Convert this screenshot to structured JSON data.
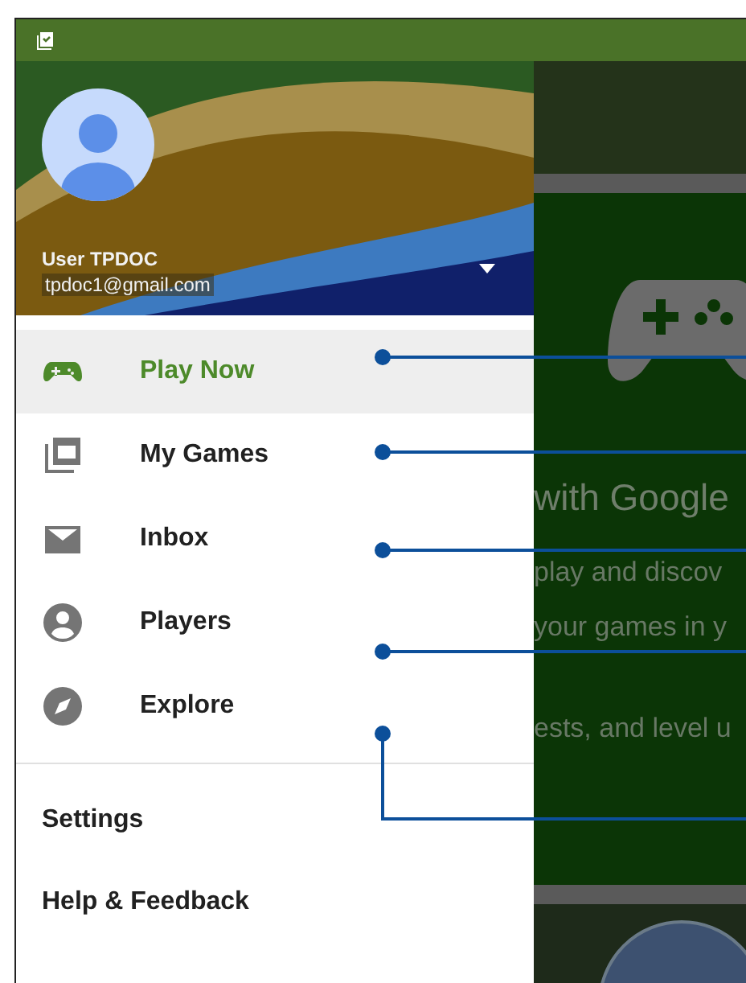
{
  "account": {
    "name": "User TPDOC",
    "email": "tpdoc1@gmail.com"
  },
  "menu": [
    {
      "label": "Play Now",
      "kind": "gamepad",
      "selected": true
    },
    {
      "label": "My Games",
      "kind": "library",
      "selected": false
    },
    {
      "label": "Inbox",
      "kind": "mail",
      "selected": false
    },
    {
      "label": "Players",
      "kind": "person",
      "selected": false
    },
    {
      "label": "Explore",
      "kind": "compass",
      "selected": false
    }
  ],
  "secondary_menu": [
    "Settings",
    "Help & Feedback"
  ],
  "background_content": {
    "heading": "with Google",
    "lines": [
      "play and discov",
      "your games in y",
      "ests, and level u"
    ]
  }
}
